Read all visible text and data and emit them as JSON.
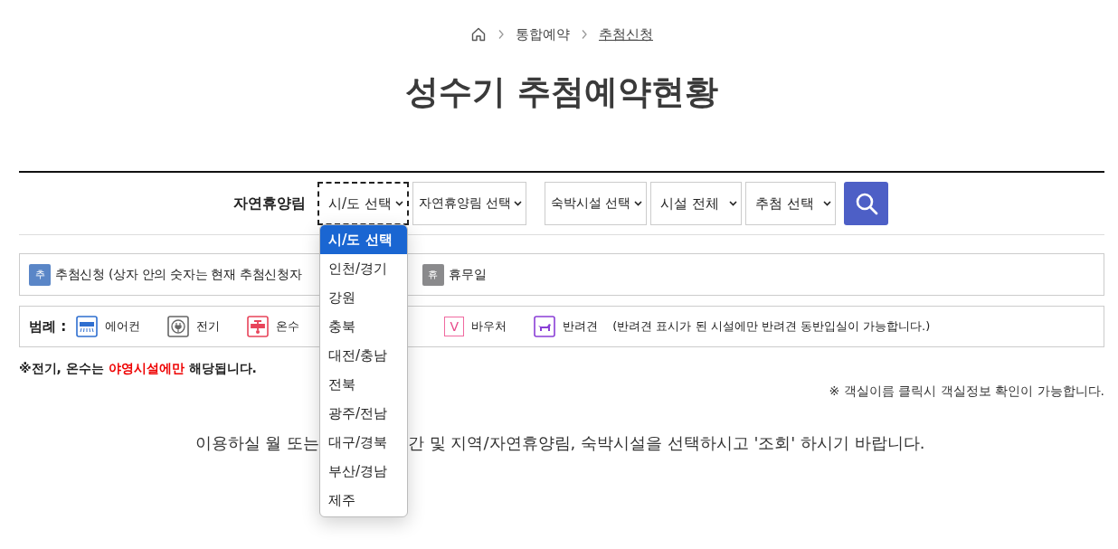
{
  "breadcrumb": [
    {
      "label": "통합예약",
      "current": false
    },
    {
      "label": "추첨신청",
      "current": true
    }
  ],
  "title": "성수기 추첨예약현황",
  "search": {
    "label": "자연휴양림",
    "selects": [
      {
        "value": "시/도 선택",
        "focused": true
      },
      {
        "value": "자연휴양림 선택",
        "focused": false
      },
      {
        "value": "숙박시설 선택",
        "focused": false
      },
      {
        "value": "시설 전체",
        "focused": false
      },
      {
        "value": "추첨 선택",
        "focused": false
      }
    ]
  },
  "dropdown": [
    {
      "label": "시/도 선택",
      "selected": true
    },
    {
      "label": "인천/경기",
      "selected": false
    },
    {
      "label": "강원",
      "selected": false
    },
    {
      "label": "충북",
      "selected": false
    },
    {
      "label": "대전/충남",
      "selected": false
    },
    {
      "label": "전북",
      "selected": false
    },
    {
      "label": "광주/전남",
      "selected": false
    },
    {
      "label": "대구/경북",
      "selected": false
    },
    {
      "label": "부산/경남",
      "selected": false
    },
    {
      "label": "제주",
      "selected": false
    }
  ],
  "status_legend": [
    {
      "badge": "추",
      "color": "#5a86c7",
      "label": "추첨신청 (상자 안의 숫자는 현재 추첨신청자"
    },
    {
      "badge": "휴",
      "color": "#8a8a8c",
      "label": "휴무일"
    }
  ],
  "legend": {
    "title": "범례 :",
    "items": [
      {
        "kind": "aircon",
        "label": "에어컨"
      },
      {
        "kind": "power",
        "label": "전기"
      },
      {
        "kind": "hotwater",
        "label": "온수"
      },
      {
        "kind": "voucher",
        "mark": "V",
        "label": "바우처"
      },
      {
        "kind": "pet",
        "label": "반려견"
      }
    ],
    "note": "(반려견 표시가 된 시설에만 반려견 동반입실이 가능합니다.)"
  },
  "notice": "※전기, 온수는 **야영시설에만** 해당됩니다.",
  "room_note": "※ 객실이름 클릭시 객실정보 확인이 가능합니다.",
  "message": {
    "before": "이용하실 월 또는",
    "after": "간 및 지역/자연휴양림, 숙박시설을 선택하시고 '조회' 하시기 바랍니다."
  }
}
